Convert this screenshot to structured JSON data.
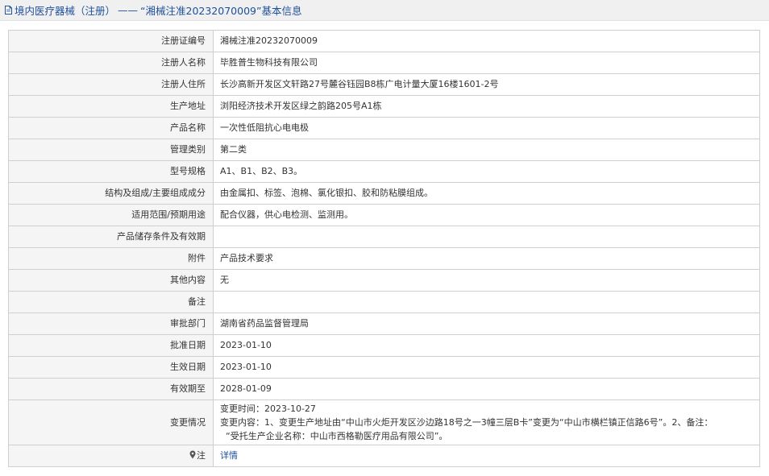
{
  "header": {
    "category": "境内医疗器械（注册）",
    "separator": "——",
    "record_title": "“湘械注准20232070009”基本信息"
  },
  "rows": [
    {
      "label": "注册证编号",
      "value": "湘械注准20232070009"
    },
    {
      "label": "注册人名称",
      "value": "毕胜普生物科技有限公司"
    },
    {
      "label": "注册人住所",
      "value": "长沙高新开发区文轩路27号麓谷钰园B8栋广电计量大厦16楼1601-2号"
    },
    {
      "label": "生产地址",
      "value": "浏阳经济技术开发区绿之韵路205号A1栋"
    },
    {
      "label": "产品名称",
      "value": "一次性低阻抗心电电极"
    },
    {
      "label": "管理类别",
      "value": "第二类"
    },
    {
      "label": "型号规格",
      "value": "A1、B1、B2、B3。"
    },
    {
      "label": "结构及组成/主要组成成分",
      "value": "由金属扣、标签、泡棉、氯化银扣、胶和防粘膜组成。"
    },
    {
      "label": "适用范围/预期用途",
      "value": "配合仪器，供心电检测、监测用。"
    },
    {
      "label": "产品储存条件及有效期",
      "value": ""
    },
    {
      "label": "附件",
      "value": "产品技术要求"
    },
    {
      "label": "其他内容",
      "value": "无"
    },
    {
      "label": "备注",
      "value": ""
    },
    {
      "label": "审批部门",
      "value": "湖南省药品监督管理局"
    },
    {
      "label": "批准日期",
      "value": "2023-01-10"
    },
    {
      "label": "生效日期",
      "value": "2023-01-10"
    },
    {
      "label": "有效期至",
      "value": "2028-01-09"
    }
  ],
  "change": {
    "label": "变更情况",
    "time_line": "变更时间：2023-10-27",
    "content_line1": "变更内容：1、变更生产地址由“中山市火炬开发区沙边路18号之一3幢三层B卡”变更为“中山市横栏镇正信路6号”。2、备注：",
    "content_line2": "“受托生产企业名称：中山市西格勒医疗用品有限公司”。"
  },
  "note_row": {
    "label": "注",
    "link_text": "详情"
  }
}
